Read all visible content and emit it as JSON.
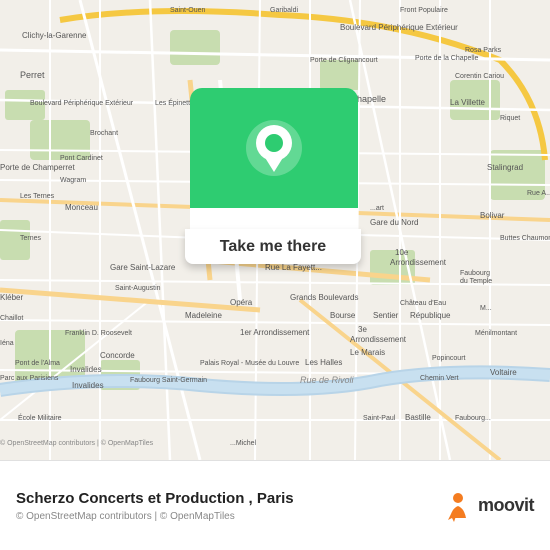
{
  "map": {
    "alt": "Map of Paris centered near Gare du Nord",
    "pin_color": "#2ecc71",
    "pin_icon": "location-pin"
  },
  "cta": {
    "label": "Take me there"
  },
  "info_bar": {
    "venue_name": "Scherzo Concerts et Production",
    "city": "Paris",
    "copyright": "© OpenStreetMap contributors | © OpenMapTiles",
    "moovit_logo_text": "moovit"
  }
}
